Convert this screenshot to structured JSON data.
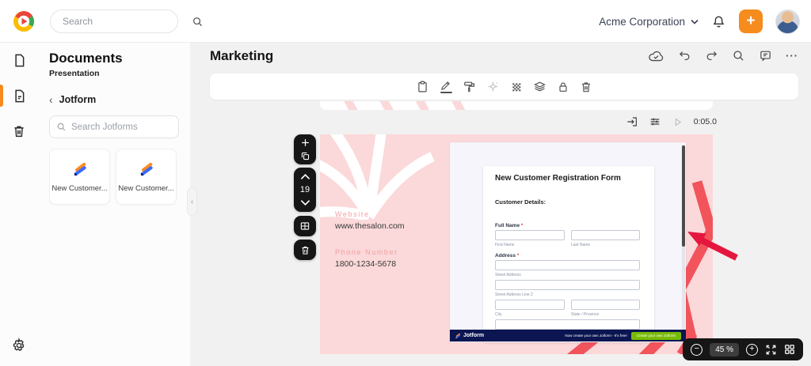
{
  "colors": {
    "accent_orange": "#f68b1e",
    "slide_pink": "#fbd8d9",
    "slide_text_pink": "#f2a0a3",
    "jotform_navy": "#0a1551",
    "cta_green": "#78bb07",
    "annotation_red": "#e5173f",
    "decor_red": "#f2545c"
  },
  "icons": {
    "plus": "+",
    "minus": "−",
    "more_horizontal": "···",
    "chevron_left": "‹"
  },
  "topbar": {
    "search_placeholder": "Search",
    "org_name": "Acme Corporation"
  },
  "panel": {
    "title": "Documents",
    "subtitle": "Presentation",
    "back_label": "Jotform",
    "search_placeholder": "Search Jotforms",
    "cards": [
      {
        "label": "New Customer..."
      },
      {
        "label": "New Customer..."
      }
    ]
  },
  "main": {
    "title": "Marketing"
  },
  "slide_nav": {
    "current_slide": "19",
    "duration": "0:05.0"
  },
  "slide": {
    "website_label": "Website",
    "website_value": "www.thesalon.com",
    "phone_label": "Phone Number",
    "phone_value": "1800-1234-5678"
  },
  "form": {
    "title": "New Customer Registration Form",
    "section_title": "Customer Details:",
    "full_name_label": "Full Name",
    "address_label": "Address",
    "required_mark": "*",
    "sub_first_name": "First Name",
    "sub_last_name": "Last Name",
    "sub_street": "Street Address",
    "sub_street2": "Street Address Line 2",
    "sub_city": "City",
    "sub_state": "State / Province",
    "footer_brand": "Jotform",
    "footer_tagline": "Now create your own Jotform - It's free!",
    "footer_cta": "Create your own Jotform"
  },
  "zoombar": {
    "zoom_level": "45 %"
  }
}
